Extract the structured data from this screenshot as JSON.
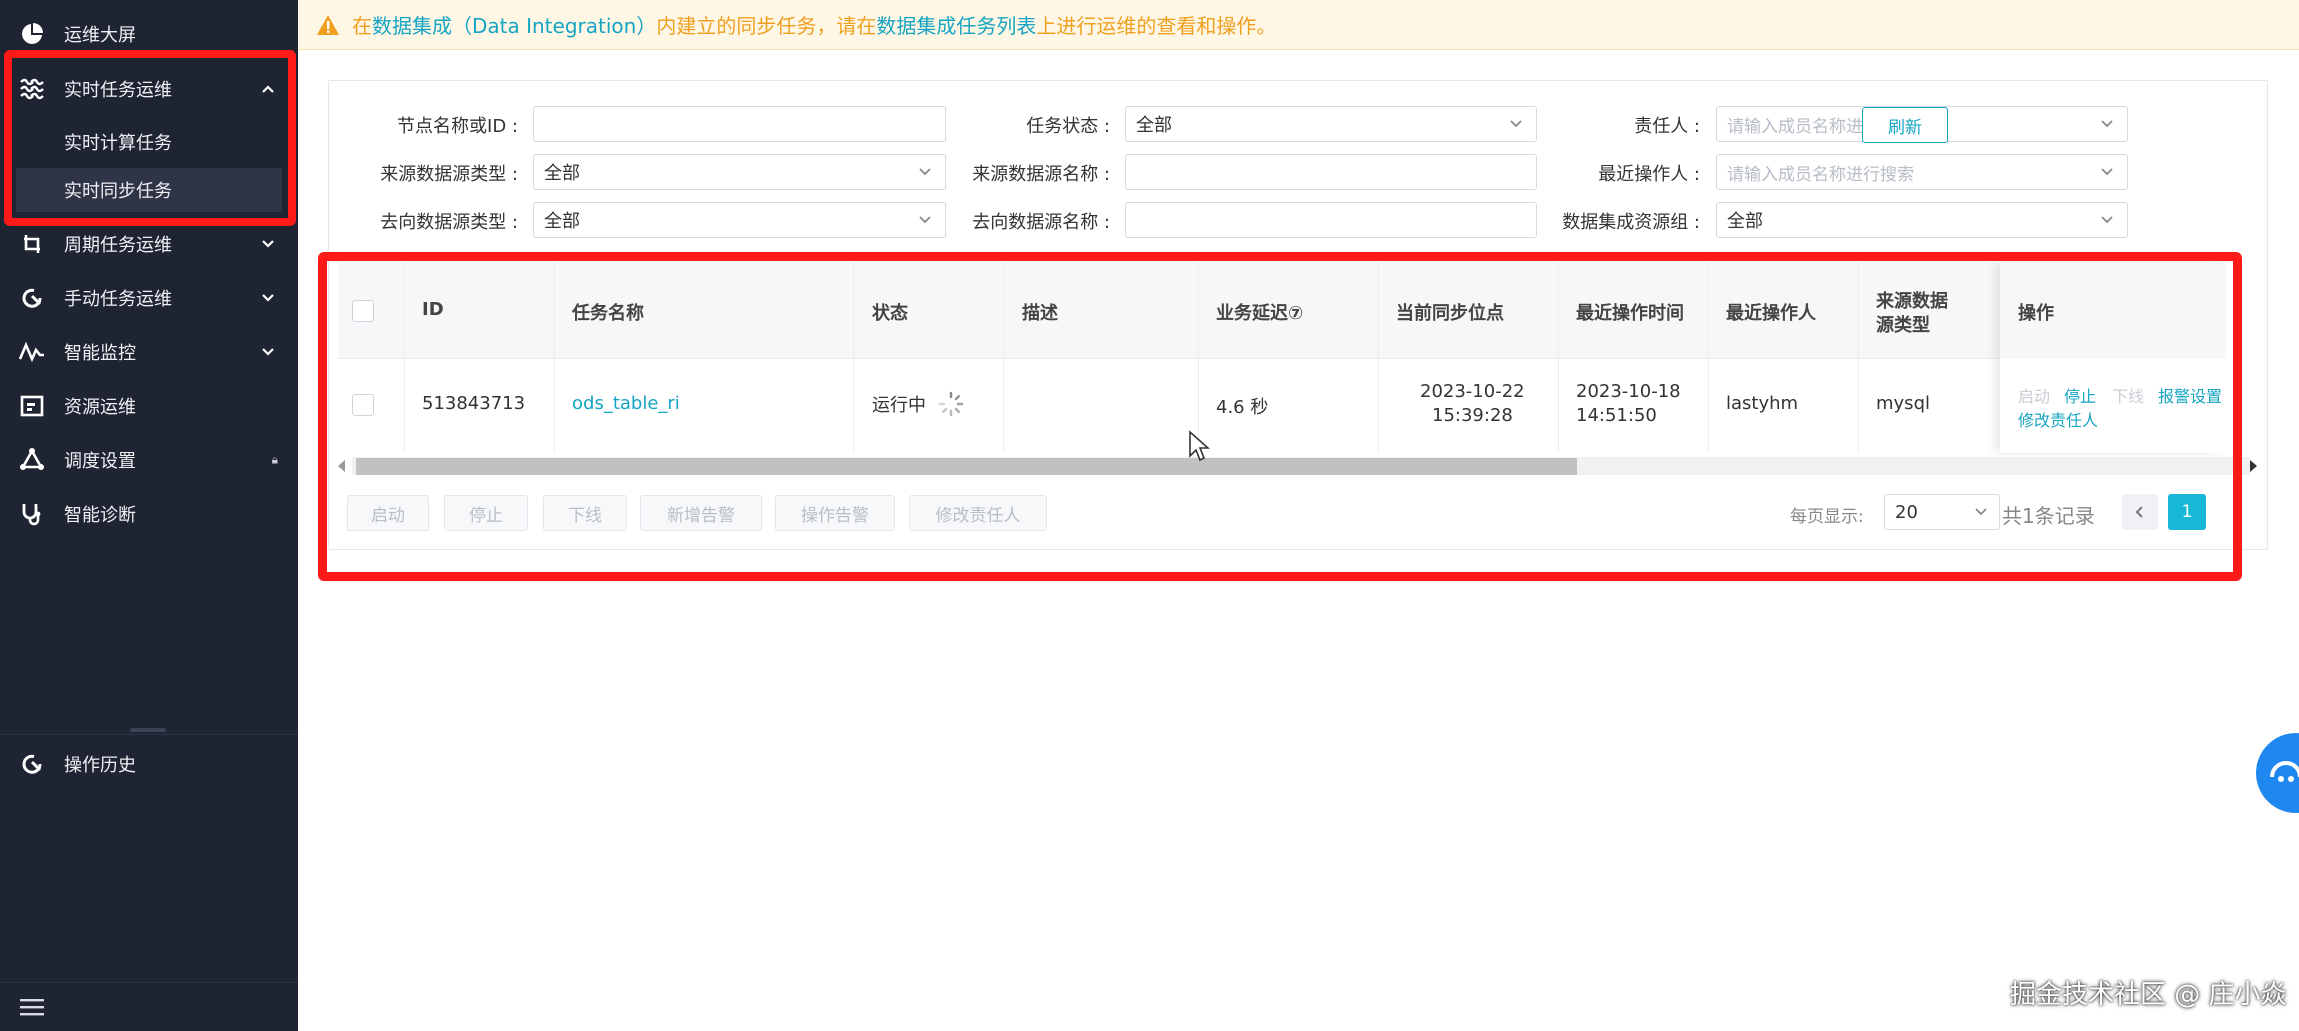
{
  "sidebar": {
    "items": [
      {
        "label": "运维大屏",
        "icon": "pie-chart-icon"
      },
      {
        "label": "实时任务运维",
        "icon": "wave-icon"
      },
      {
        "label": "周期任务运维",
        "icon": "cycle-icon"
      },
      {
        "label": "手动任务运维",
        "icon": "manual-icon"
      },
      {
        "label": "智能监控",
        "icon": "pulse-icon"
      },
      {
        "label": "资源运维",
        "icon": "resource-icon"
      },
      {
        "label": "调度设置",
        "icon": "schedule-icon"
      },
      {
        "label": "智能诊断",
        "icon": "stethoscope-icon"
      }
    ],
    "sub_items": [
      {
        "label": "实时计算任务"
      },
      {
        "label": "实时同步任务"
      }
    ],
    "history": {
      "label": "操作历史"
    }
  },
  "notice": {
    "prefix": "在 ",
    "link1": "数据集成（Data Integration）",
    "middle": "内建立的同步任务，请在",
    "link2": "数据集成任务列表",
    "suffix": "上进行运维的查看和操作。"
  },
  "filters": {
    "node_name_label": "节点名称或ID :",
    "node_name_value": "",
    "task_status_label": "任务状态 :",
    "task_status_value": "全部",
    "owner_label": "责任人 :",
    "owner_placeholder": "请输入成员名称进行搜索",
    "src_type_label": "来源数据源类型 :",
    "src_type_value": "全部",
    "src_name_label": "来源数据源名称 :",
    "src_name_value": "",
    "recent_op_label": "最近操作人 :",
    "recent_op_placeholder": "请输入成员名称进行搜索",
    "dst_type_label": "去向数据源类型 :",
    "dst_type_value": "全部",
    "dst_name_label": "去向数据源名称 :",
    "dst_name_value": "",
    "res_group_label": "数据集成资源组 :",
    "res_group_value": "全部",
    "refresh_label": "刷新"
  },
  "table": {
    "headers": {
      "id": "ID",
      "name": "任务名称",
      "status": "状态",
      "desc": "描述",
      "delay": "业务延迟⑦",
      "sync_point": "当前同步位点",
      "op_time": "最近操作时间",
      "operator": "最近操作人",
      "src_type_1": "来源数据",
      "src_type_2": "源类型",
      "ops": "操作"
    },
    "row": {
      "id": "513843713",
      "name": "ods_table_ri",
      "status": "运行中",
      "desc": "",
      "delay": "4.6 秒",
      "sync_date": "2023-10-22",
      "sync_time": "15:39:28",
      "op_date": "2023-10-18",
      "op_time": "14:51:50",
      "operator": "lastyhm",
      "src_type": "mysql",
      "op_start": "启动",
      "op_stop": "停止",
      "op_offline": "下线",
      "op_alarm": "报警设置",
      "op_change_owner": "修改责任人"
    }
  },
  "batch": {
    "start": "启动",
    "stop": "停止",
    "offline": "下线",
    "add_alarm": "新增告警",
    "op_alarm": "操作告警",
    "change_owner": "修改责任人"
  },
  "pagination": {
    "per_page_label": "每页显示:",
    "per_page_value": "20",
    "total": "共1条记录",
    "current_page": "1"
  },
  "watermark": "掘金技术社区 @ 庄小焱",
  "colors": {
    "sidebar_bg": "#1f2433",
    "accent": "#16a5c2",
    "highlight_border": "#ff1a1a",
    "notice_text": "#f0a020"
  }
}
